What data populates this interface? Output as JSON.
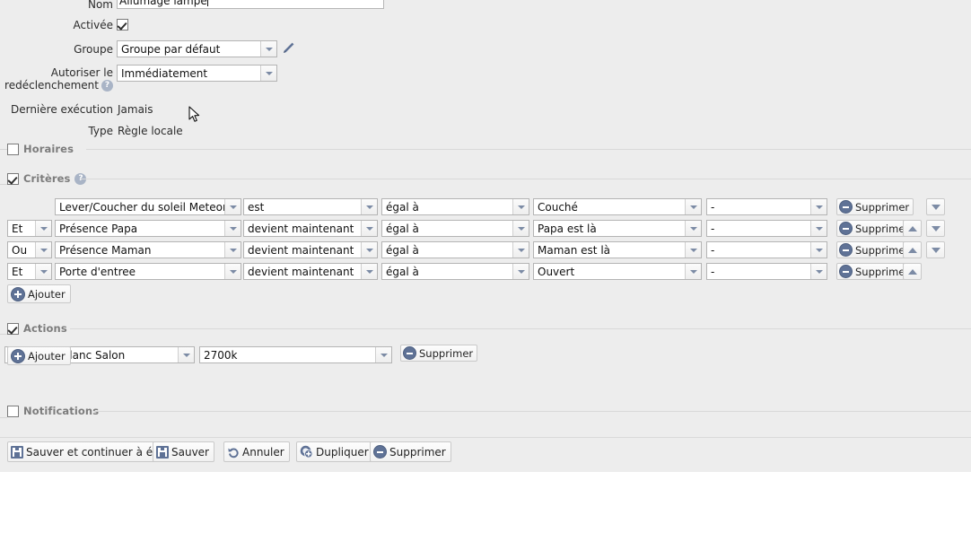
{
  "form": {
    "name_label": "Nom",
    "name_value": "Allumage lampe",
    "enabled_label": "Activée",
    "enabled_checked": true,
    "group_label": "Groupe",
    "group_value": "Groupe par défaut",
    "retrigger_label_line1": "Autoriser le",
    "retrigger_label_line2": "redéclenchement",
    "retrigger_value": "Immédiatement",
    "last_exec_label": "Dernière exécution",
    "last_exec_value": "Jamais",
    "type_label": "Type",
    "type_value": "Règle locale",
    "edit_group_icon": "pencil-icon",
    "help_icon": "help-icon"
  },
  "sections": {
    "schedules": {
      "label": "Horaires",
      "checked": false
    },
    "criteria": {
      "label": "Critères",
      "checked": true,
      "help": "?"
    },
    "actions": {
      "label": "Actions",
      "checked": true
    },
    "notifications": {
      "label": "Notifications",
      "checked": false
    }
  },
  "criteria": {
    "add_label": "Ajouter",
    "delete_label": "Supprimer",
    "rows": [
      {
        "logic": "",
        "has_logic": false,
        "device": "Lever/Coucher du soleil Meteorolo",
        "operator": "est",
        "comparator": "égal à",
        "value": "Couché",
        "extra": "-",
        "has_up": false,
        "has_down": true
      },
      {
        "logic": "Et",
        "has_logic": true,
        "device": "Présence Papa",
        "operator": "devient maintenant",
        "comparator": "égal à",
        "value": "Papa est là",
        "extra": "-",
        "has_up": true,
        "has_down": true
      },
      {
        "logic": "Ou",
        "has_logic": true,
        "device": "Présence Maman",
        "operator": "devient maintenant",
        "comparator": "égal à",
        "value": "Maman est là",
        "extra": "-",
        "has_up": true,
        "has_down": true
      },
      {
        "logic": "Et",
        "has_logic": true,
        "device": "Porte d'entree",
        "operator": "devient maintenant",
        "comparator": "égal à",
        "value": "Ouvert",
        "extra": "-",
        "has_up": true,
        "has_down": false
      }
    ]
  },
  "actions": {
    "add_label": "Ajouter",
    "delete_label": "Supprimer",
    "rows": [
      {
        "target": "Yeelight - Blanc Salon",
        "value": "2700k"
      }
    ]
  },
  "toolbar": {
    "save_continue_label": "Sauver et continuer à éditer",
    "save_label": "Sauver",
    "cancel_label": "Annuler",
    "duplicate_label": "Dupliquer",
    "delete_label": "Supprimer"
  },
  "colors": {
    "background": "#ededed",
    "accent": "#5f7296",
    "legend": "#7c7c7c",
    "arrow": "#7c8ba5"
  }
}
